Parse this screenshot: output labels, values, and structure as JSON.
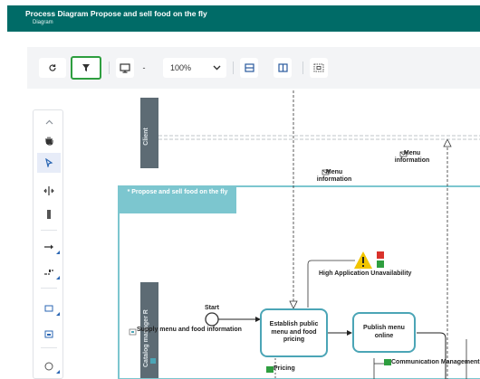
{
  "header": {
    "title": "Process Diagram Propose and sell food on the fly",
    "subtitle": "Diagram"
  },
  "toolbar": {
    "zoom_separator": "-",
    "zoom_value": "100%",
    "filter_highlight_color": "#2e9e3f"
  },
  "palette": {
    "items": [
      "chevron-up-icon",
      "hand-icon",
      "pointer-icon",
      "split-icon",
      "column-icon",
      "arrow-right-icon",
      "connector-icon",
      "rectangle-icon",
      "note-icon",
      "circle-icon"
    ]
  },
  "diagram": {
    "lane_client": "Client",
    "pool_title": "* Propose and sell food on the fly",
    "lane_catalog": "Catalog manager R",
    "messages": {
      "menu_info_left": "Menu information",
      "menu_info_right": "Menu information"
    },
    "risk_label": "High Application Unavailability",
    "start_label": "Start",
    "data_supply": "Supply menu and food information",
    "task_establish": "Establish public menu and food pricing",
    "task_publish": "Publish menu online",
    "data_pricing": "Pricing",
    "data_comm": "Communication Management"
  },
  "colors": {
    "header_bg": "#006b67",
    "lane_gray": "#5d6b74",
    "pool_teal": "#7cc6cf",
    "task_border": "#4ba5b6",
    "risk_yellow": "#f2c500",
    "risk_red": "#d9322b",
    "risk_green": "#2e9e3f"
  }
}
